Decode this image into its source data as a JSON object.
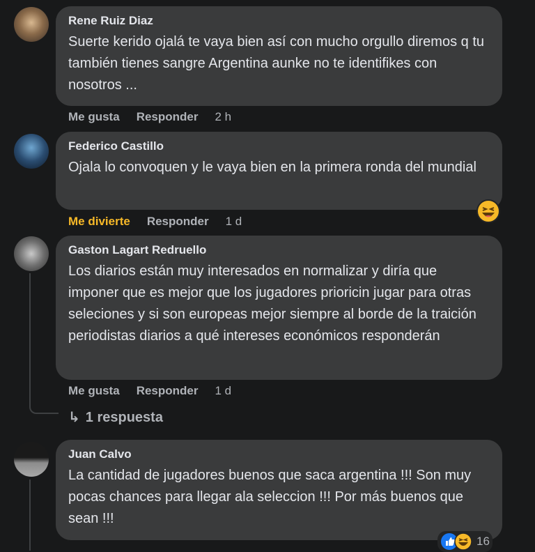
{
  "comments": [
    {
      "author": "Rene Ruiz Diaz",
      "text": "Suerte kerido ojalá te vaya bien así con mucho orgullo diremos q tu también tienes sangre Argentina aunke no te identifikes con nosotros ...",
      "actions": {
        "like": "Me gusta",
        "reply": "Responder",
        "time": "2 h"
      }
    },
    {
      "author": "Federico Castillo",
      "text": "Ojala lo convoquen y le vaya bien en la primera ronda del mundial",
      "actions": {
        "like": "Me divierte",
        "reply": "Responder",
        "time": "1 d"
      },
      "reaction_icon": "haha-emoji-icon"
    },
    {
      "author": "Gaston Lagart Redruello",
      "text": "Los diarios están muy interesados en normalizar y diría que imponer que es mejor que los jugadores prioricin jugar para otras seleciones y si son europeas mejor siempre al borde de la traición periodistas diarios a qué intereses económicos responderán",
      "actions": {
        "like": "Me gusta",
        "reply": "Responder",
        "time": "1 d"
      },
      "replies_link": "1 respuesta"
    },
    {
      "author": "Juan Calvo",
      "text": "La cantidad de jugadores buenos que saca argentina !!! Son muy pocas chances para llegar ala seleccion !!! Por más buenos que sean !!!",
      "reaction_count": "16"
    }
  ],
  "colors": {
    "background": "#18191a",
    "bubble": "#3a3b3c",
    "text": "#e4e6eb",
    "secondary": "#b0b3b8",
    "haha": "#f7b928",
    "like": "#1877f2"
  }
}
